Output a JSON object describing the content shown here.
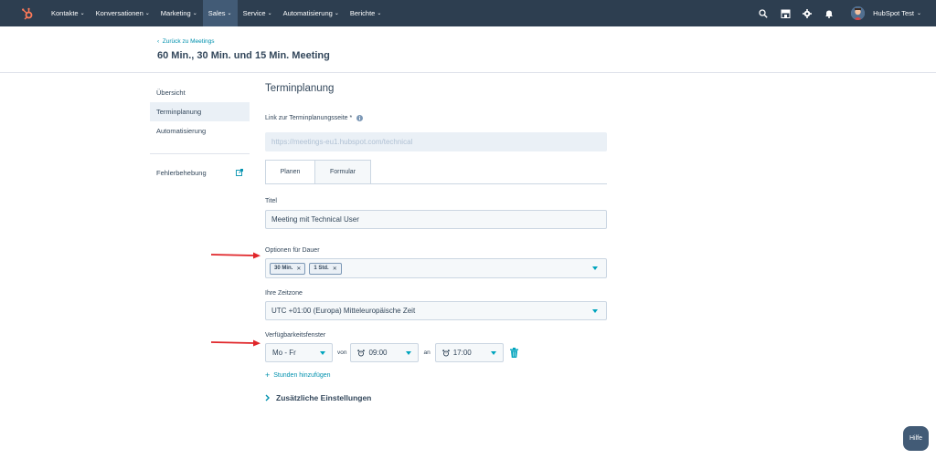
{
  "nav": {
    "items": [
      {
        "label": "Kontakte"
      },
      {
        "label": "Konversationen"
      },
      {
        "label": "Marketing"
      },
      {
        "label": "Sales"
      },
      {
        "label": "Service"
      },
      {
        "label": "Automatisierung"
      },
      {
        "label": "Berichte"
      }
    ],
    "active": "Sales",
    "account_name": "HubSpot Test",
    "icons": [
      "search-icon",
      "marketplace-icon",
      "gear-icon",
      "bell-icon"
    ]
  },
  "header": {
    "back_link": "Zurück zu Meetings",
    "title": "60 Min., 30 Min. und 15 Min. Meeting"
  },
  "sidebar": {
    "items": [
      {
        "label": "Übersicht"
      },
      {
        "label": "Terminplanung"
      },
      {
        "label": "Automatisierung"
      }
    ],
    "active": "Terminplanung",
    "troubleshooting": "Fehlerbehebung"
  },
  "main": {
    "section_title": "Terminplanung",
    "link_label": "Link zur Terminplanungsseite *",
    "link_placeholder": "https://meetings-eu1.hubspot.com/technical",
    "tabs": [
      {
        "label": "Planen"
      },
      {
        "label": "Formular"
      }
    ],
    "active_tab": "Planen",
    "title_label": "Titel",
    "title_value": "Meeting mit Technical User",
    "duration_label": "Optionen für Dauer",
    "duration_chips": [
      {
        "label": "30 Min."
      },
      {
        "label": "1 Std."
      }
    ],
    "timezone_label": "Ihre Zeitzone",
    "timezone_value": "UTC +01:00 (Europa) Mitteleuropäische Zeit",
    "availability_label": "Verfügbarkeitsfenster",
    "days_value": "Mo - Fr",
    "from_label": "von",
    "from_time": "09:00",
    "to_label": "an",
    "to_time": "17:00",
    "add_hours": "Stunden hinzufügen",
    "extra_settings": "Zusätzliche Einstellungen"
  },
  "help_button": "Hilfe",
  "colors": {
    "nav_bg": "#2d3e50",
    "accent": "#00a4bd",
    "link": "#0091ae",
    "logo": "#ff7a59",
    "annotation_arrow": "#e0262a"
  }
}
